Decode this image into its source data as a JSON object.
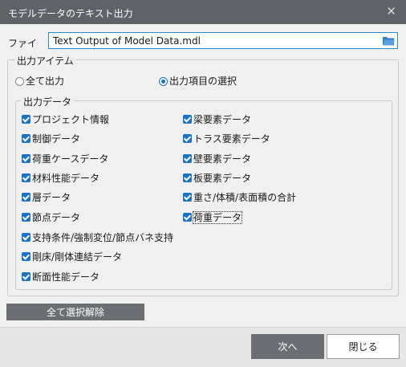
{
  "window": {
    "title": "モデルデータのテキスト出力",
    "close_glyph": "✕"
  },
  "file": {
    "label": "ファイ",
    "value": "Text Output of Model Data.mdl"
  },
  "output_items": {
    "legend": "出力アイテム",
    "options": [
      {
        "label": "全て出力",
        "selected": false
      },
      {
        "label": "出力項目の選択",
        "selected": true
      }
    ]
  },
  "output_data": {
    "legend": "出力データ",
    "left": [
      {
        "label": "プロジェクト情報",
        "checked": true
      },
      {
        "label": "制御データ",
        "checked": true
      },
      {
        "label": "荷重ケースデータ",
        "checked": true
      },
      {
        "label": "材料性能データ",
        "checked": true
      },
      {
        "label": "層データ",
        "checked": true
      },
      {
        "label": "節点データ",
        "checked": true
      },
      {
        "label": "支持条件/強制変位/節点バネ支持",
        "checked": true
      },
      {
        "label": "剛床/剛体連結データ",
        "checked": true
      },
      {
        "label": "断面性能データ",
        "checked": true
      }
    ],
    "right": [
      {
        "label": "梁要素データ",
        "checked": true
      },
      {
        "label": "トラス要素データ",
        "checked": true
      },
      {
        "label": "壁要素データ",
        "checked": true
      },
      {
        "label": "板要素データ",
        "checked": true
      },
      {
        "label": "重さ/体積/表面積の合計",
        "checked": true
      },
      {
        "label": "荷重データ",
        "checked": true
      }
    ]
  },
  "buttons": {
    "clear_all": "全て選択解除",
    "next": "次へ",
    "close": "閉じる"
  },
  "colors": {
    "accent": "#1a73c4",
    "titlebar": "#5f6368",
    "button_dark": "#6b6e73"
  }
}
